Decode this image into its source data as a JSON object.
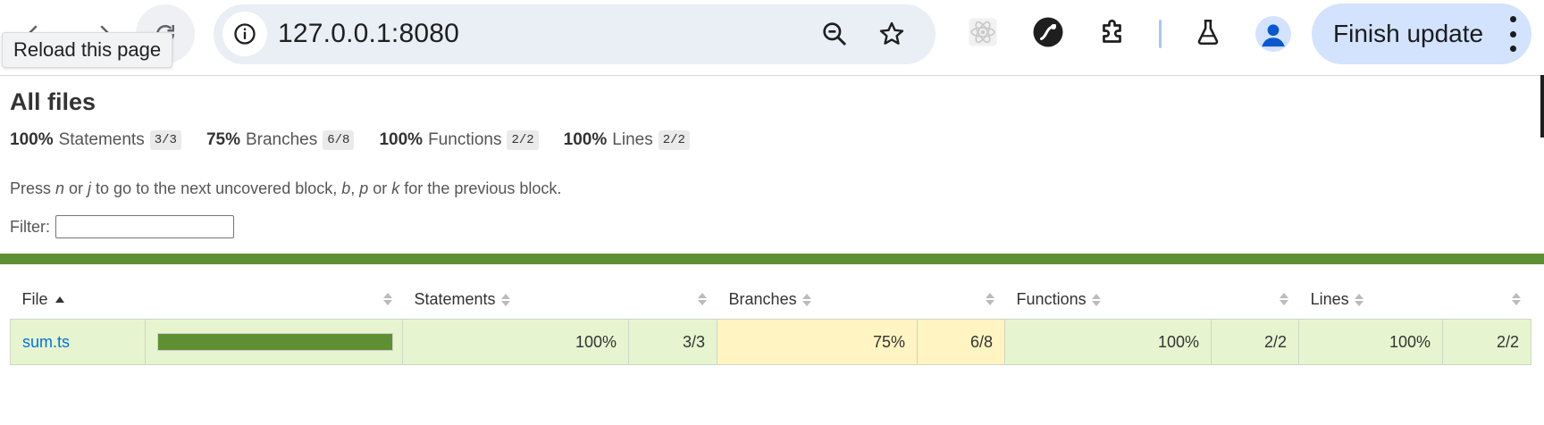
{
  "browser": {
    "url": "127.0.0.1:8080",
    "tooltip": "Reload this page",
    "finish_update_label": "Finish update"
  },
  "report": {
    "title": "All files",
    "summary": [
      {
        "pct": "100%",
        "label": "Statements",
        "fraction": "3/3"
      },
      {
        "pct": "75%",
        "label": "Branches",
        "fraction": "6/8"
      },
      {
        "pct": "100%",
        "label": "Functions",
        "fraction": "2/2"
      },
      {
        "pct": "100%",
        "label": "Lines",
        "fraction": "2/2"
      }
    ],
    "hint": {
      "part1": "Press ",
      "key_n": "n",
      "part2": " or ",
      "key_j": "j",
      "part3": " to go to the next uncovered block, ",
      "key_b": "b",
      "part4": ", ",
      "key_p": "p",
      "part5": " or ",
      "key_k": "k",
      "part6": " for the previous block."
    },
    "filter_label": "Filter:",
    "filter_value": "",
    "table": {
      "headers": {
        "file": "File",
        "statements": "Statements",
        "branches": "Branches",
        "functions": "Functions",
        "lines": "Lines"
      },
      "rows": [
        {
          "file": "sum.ts",
          "coverage_fraction": 1.0,
          "statements_pct": "100%",
          "statements_frac": "3/3",
          "branches_pct": "75%",
          "branches_frac": "6/8",
          "functions_pct": "100%",
          "functions_frac": "2/2",
          "lines_pct": "100%",
          "lines_frac": "2/2"
        }
      ]
    }
  },
  "colors": {
    "high": "#e6f5d0",
    "medium": "#fff4c2",
    "bar": "#5f8f33",
    "link": "#0074d9"
  },
  "icons": [
    "back-arrow-icon",
    "forward-arrow-icon",
    "reload-icon",
    "info-icon",
    "zoom-out-icon",
    "star-icon",
    "react-devtools-icon",
    "extension-circle-icon",
    "puzzle-icon",
    "flask-icon",
    "profile-icon",
    "kebab-menu-icon"
  ]
}
